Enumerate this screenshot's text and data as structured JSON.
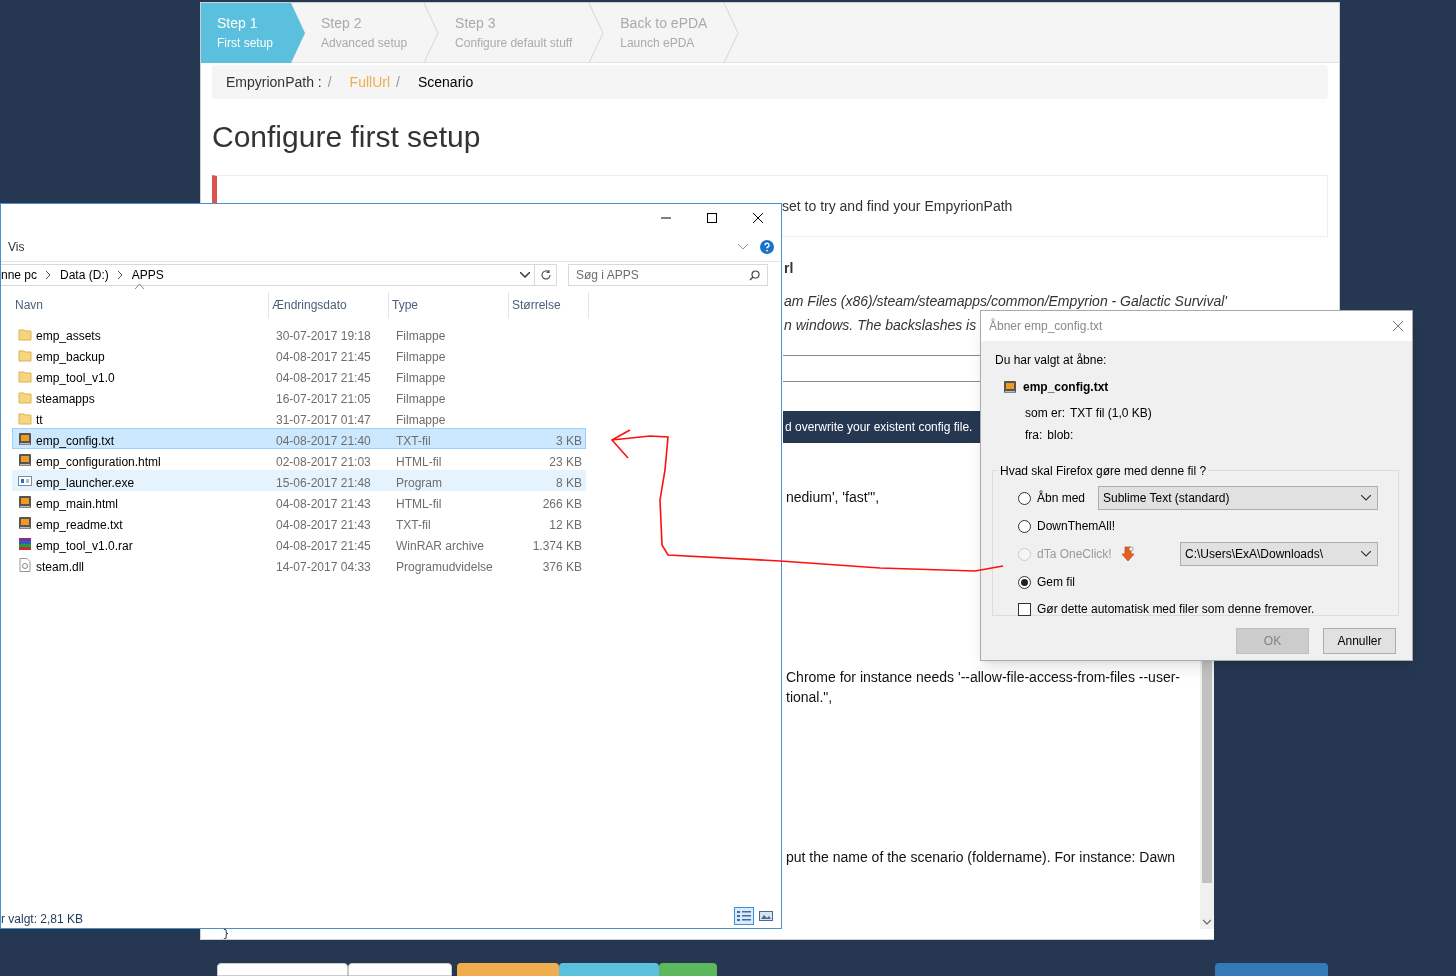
{
  "browser_page": {
    "wizard_steps": [
      {
        "title": "Step 1",
        "subtitle": "First setup",
        "selected": true
      },
      {
        "title": "Step 2",
        "subtitle": "Advanced setup",
        "selected": false
      },
      {
        "title": "Step 3",
        "subtitle": "Configure default stuff",
        "selected": false
      },
      {
        "title": "Back to ePDA",
        "subtitle": "Launch ePDA",
        "selected": false
      }
    ],
    "breadcrumb": [
      {
        "text": "EmpyrionPath :",
        "separator": "/",
        "color": "#333333"
      },
      {
        "text": "FullUrl",
        "separator": "/",
        "color": "#f0ad4e"
      },
      {
        "text": "Scenario",
        "color": "#000000"
      }
    ],
    "heading": "Configure first setup",
    "note": "set to try and find your EmpyrionPath",
    "form_fragments": [
      {
        "kind": "label",
        "text": "rl"
      },
      {
        "kind": "hint",
        "text": "am Files (x86)/steam/steamapps/common/Empyrion - Galactic Survival'"
      },
      {
        "kind": "hint",
        "text": "n windows. The backslashes is"
      },
      {
        "kind": "field"
      },
      {
        "kind": "banner",
        "text": "d overwrite your existent config file."
      },
      {
        "kind": "text",
        "text": "nedium', 'fast'\","
      },
      {
        "kind": "text",
        "text": "Chrome for instance needs '--allow-file-access-from-files --user-"
      },
      {
        "kind": "text",
        "text": "tional.\","
      },
      {
        "kind": "text",
        "text": "put the name of the scenario (foldername). For instance: Dawn"
      },
      {
        "kind": "code",
        "text": "}"
      }
    ]
  },
  "file_explorer": {
    "ribbon_tab": "Vis",
    "address": [
      "nne pc",
      "Data (D:)",
      "APPS"
    ],
    "search": {
      "placeholder": "Søg i APPS"
    },
    "columns": [
      "Navn",
      "Ændringsdato",
      "Type",
      "Størrelse"
    ],
    "rows": [
      {
        "kind": "folder",
        "name": "emp_assets",
        "date": "30-07-2017 19:18",
        "type": "Filmappe",
        "selected": false,
        "hovered": false
      },
      {
        "kind": "folder",
        "name": "emp_backup",
        "date": "04-08-2017 21:45",
        "type": "Filmappe",
        "selected": false,
        "hovered": false
      },
      {
        "kind": "folder",
        "name": "emp_tool_v1.0",
        "date": "04-08-2017 21:45",
        "type": "Filmappe",
        "selected": false,
        "hovered": false
      },
      {
        "kind": "folder",
        "name": "steamapps",
        "date": "16-07-2017 21:05",
        "type": "Filmappe",
        "selected": false,
        "hovered": false
      },
      {
        "kind": "folder",
        "name": "tt",
        "date": "31-07-2017 01:47",
        "type": "Filmappe",
        "selected": false,
        "hovered": false
      },
      {
        "kind": "editor",
        "name": "emp_config.txt",
        "date": "04-08-2017 21:40",
        "type": "TXT-fil",
        "size": "3 KB",
        "selected": true,
        "hovered": false
      },
      {
        "kind": "editor",
        "name": "emp_configuration.html",
        "date": "02-08-2017 21:03",
        "type": "HTML-fil",
        "size": "23 KB",
        "selected": false,
        "hovered": false
      },
      {
        "kind": "program",
        "name": "emp_launcher.exe",
        "date": "15-06-2017 21:48",
        "type": "Program",
        "size": "8 KB",
        "selected": false,
        "hovered": true
      },
      {
        "kind": "editor",
        "name": "emp_main.html",
        "date": "04-08-2017 21:43",
        "type": "HTML-fil",
        "size": "266 KB",
        "selected": false,
        "hovered": false
      },
      {
        "kind": "editor",
        "name": "emp_readme.txt",
        "date": "04-08-2017 21:43",
        "type": "TXT-fil",
        "size": "12 KB",
        "selected": false,
        "hovered": false
      },
      {
        "kind": "archive",
        "name": "emp_tool_v1.0.rar",
        "date": "04-08-2017 21:45",
        "type": "WinRAR archive",
        "size": "1.374 KB",
        "selected": false,
        "hovered": false
      },
      {
        "kind": "library",
        "name": "steam.dll",
        "date": "14-07-2017 04:33",
        "type": "Programudvidelse",
        "size": "376 KB",
        "selected": false,
        "hovered": false
      }
    ],
    "status": "r valgt: 2,81 KB",
    "views": [
      {
        "kind": "details",
        "selected": true
      },
      {
        "kind": "thumbnails",
        "selected": false
      }
    ]
  },
  "download_dialog": {
    "title": "Åbner emp_config.txt",
    "intro": "Du har valgt at åbne:",
    "file_name": "emp_config.txt",
    "details": [
      {
        "label": "som er:",
        "value": "TXT fil (1,0 KB)"
      },
      {
        "label": "fra:",
        "value": "blob:"
      }
    ],
    "group_label": "Hvad skal Firefox gøre med denne fil ?",
    "options": [
      {
        "label": "Åbn med",
        "selected": false,
        "disabled": false,
        "dropdown": "Sublime Text (standard)"
      },
      {
        "label": "DownThemAll!",
        "selected": false,
        "disabled": false
      },
      {
        "label": "dTa OneClick!",
        "selected": false,
        "disabled": true,
        "addon_icon": true,
        "dropdown": "C:\\Users\\ExA\\Downloads\\"
      },
      {
        "label": "Gem fil",
        "selected": true,
        "disabled": false
      }
    ],
    "remember": {
      "label": "Gør dette automatisk med filer som denne fremover.",
      "checked": false
    },
    "buttons": [
      {
        "label": "OK",
        "disabled": true
      },
      {
        "label": "Annuller",
        "disabled": false
      }
    ]
  }
}
